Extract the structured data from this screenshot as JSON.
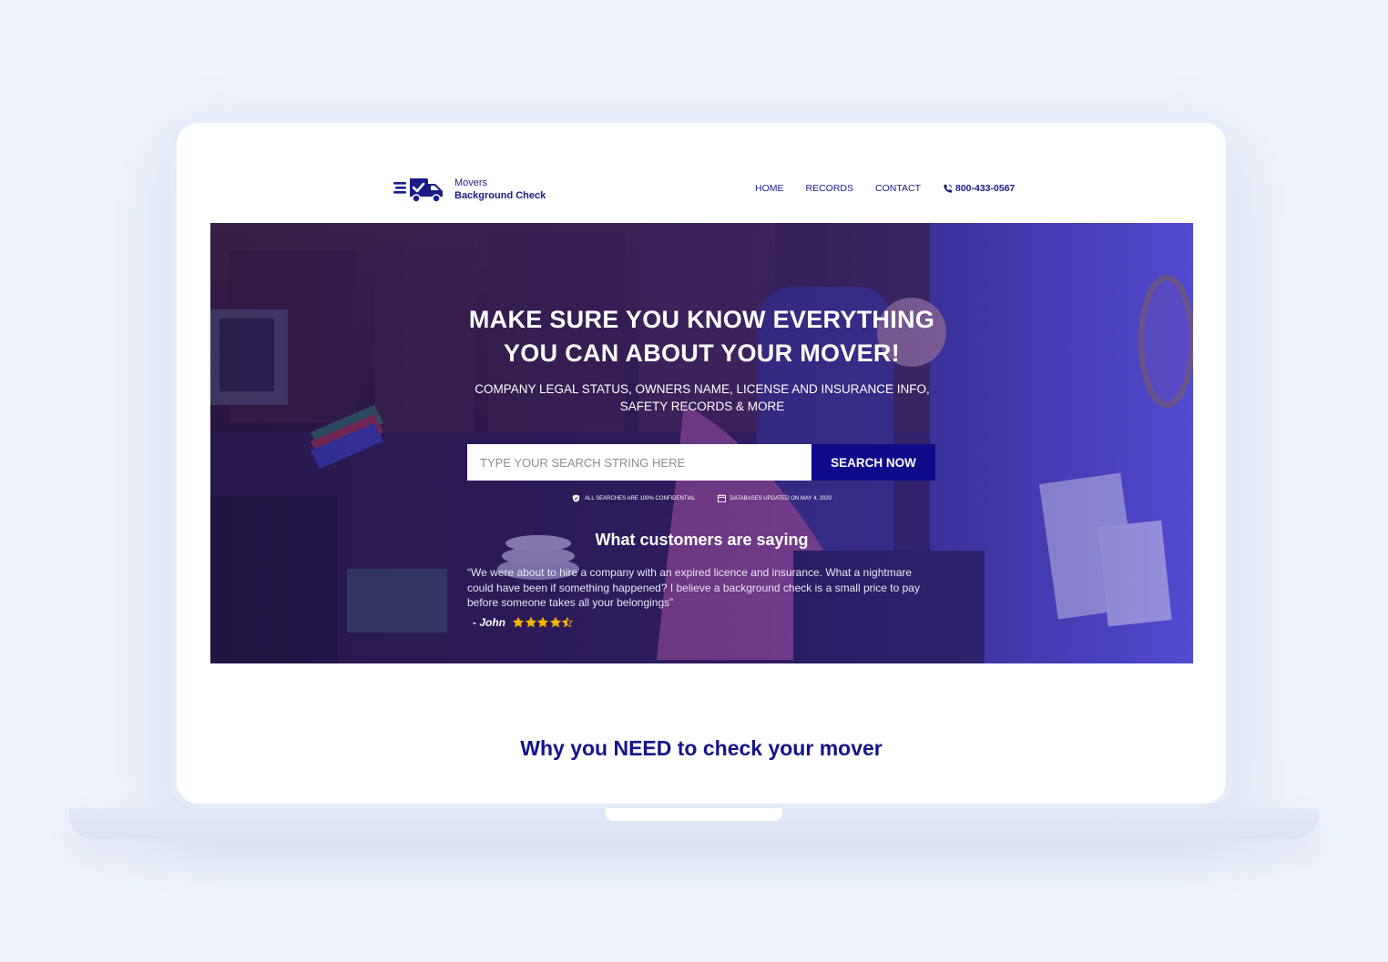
{
  "brand": {
    "line1": "Movers",
    "line2": "Background Check",
    "color": "#1a1a8a"
  },
  "nav": {
    "items": [
      "HOME",
      "RECORDS",
      "CONTACT"
    ],
    "phone": "800-433-0567"
  },
  "hero": {
    "title_line1": "MAKE SURE YOU KNOW EVERYTHING",
    "title_line2": "YOU CAN ABOUT YOUR MOVER!",
    "subtitle_line1": "COMPANY LEGAL STATUS, OWNERS NAME, LICENSE AND INSURANCE INFO,",
    "subtitle_line2": "SAFETY RECORDS & MORE",
    "search_placeholder": "TYPE YOUR SEARCH STRING HERE",
    "search_button": "SEARCH NOW",
    "trust_confidential": "ALL SEARCHES ARE 100% CONFIDENTIAL",
    "trust_updated": "DATABASES UPDATED ON MAY 4, 2020",
    "accent": "#0e0a8a"
  },
  "testimonial": {
    "heading": "What customers are saying",
    "quote": "“We were about to hire a company with an expired licence and insurance. What a nightmare could have been if something happened? I believe a background check is a small price to pay before someone takes all your belongings”",
    "author": "- John",
    "rating": 4.5,
    "star_color": "#f5b400"
  },
  "section": {
    "heading": "Why you NEED to check your mover"
  }
}
